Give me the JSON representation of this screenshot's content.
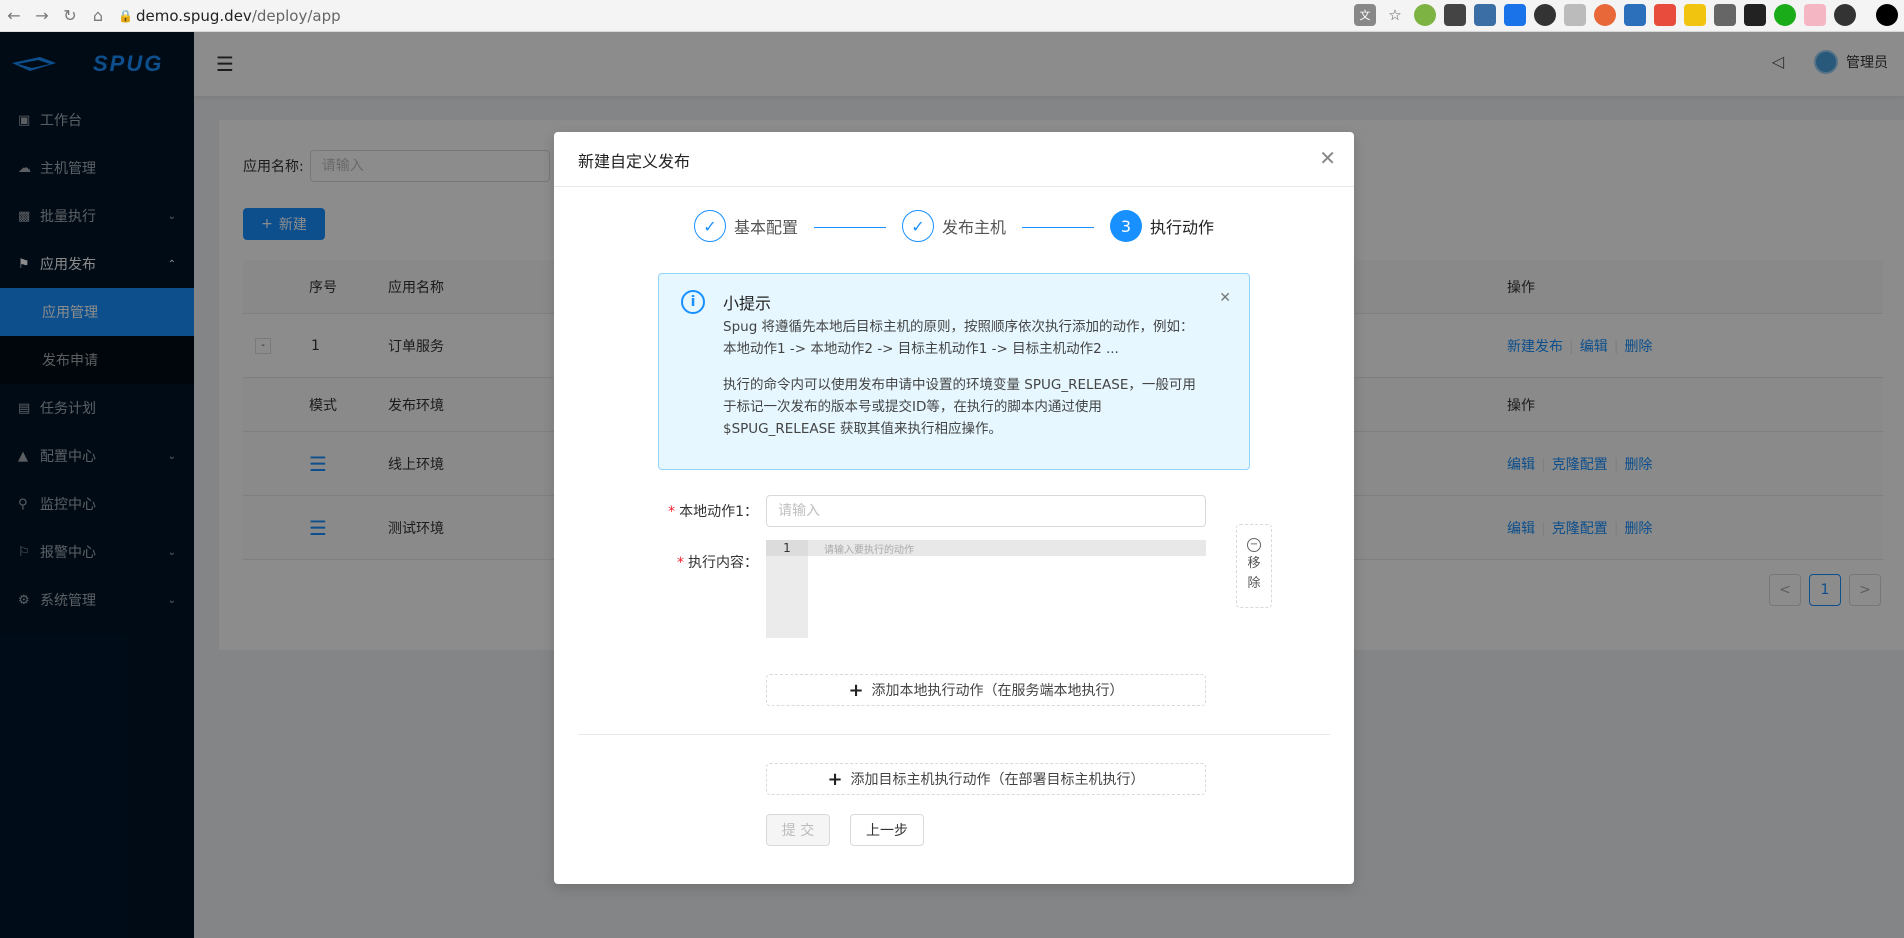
{
  "browser": {
    "url_host": "demo.spug.dev",
    "url_path": "/deploy/app"
  },
  "app": {
    "logo_text": "SPUG",
    "user_name": "管理员"
  },
  "sidebar": {
    "items": [
      {
        "label": "工作台",
        "icon": "desktop-icon"
      },
      {
        "label": "主机管理",
        "icon": "cloud-icon"
      },
      {
        "label": "批量执行",
        "icon": "code-icon",
        "has_arrow": true
      },
      {
        "label": "应用发布",
        "icon": "flag-icon",
        "has_arrow": true,
        "open": true
      },
      {
        "label": "应用管理",
        "selected": true,
        "sub": true
      },
      {
        "label": "发布申请",
        "sub": true
      },
      {
        "label": "任务计划",
        "icon": "schedule-icon"
      },
      {
        "label": "配置中心",
        "icon": "deployment-icon",
        "has_arrow": true
      },
      {
        "label": "监控中心",
        "icon": "monitor-icon"
      },
      {
        "label": "报警中心",
        "icon": "alert-icon",
        "has_arrow": true
      },
      {
        "label": "系统管理",
        "icon": "setting-icon",
        "has_arrow": true
      }
    ]
  },
  "page": {
    "search_label": "应用名称:",
    "search_placeholder": "请输入",
    "new_button": "新建",
    "table_headers": [
      "序号",
      "应用名称",
      "操作"
    ],
    "row": {
      "expand": "-",
      "index": "1",
      "name": "订单服务",
      "actions": [
        "新建发布",
        "编辑",
        "删除"
      ]
    },
    "sub_headers": [
      "模式",
      "发布环境",
      "操作"
    ],
    "sub_rows": [
      {
        "env": "线上环境",
        "actions": [
          "编辑",
          "克隆配置",
          "删除"
        ]
      },
      {
        "env": "测试环境",
        "actions": [
          "编辑",
          "克隆配置",
          "删除"
        ]
      }
    ],
    "pagination": {
      "prev": "<",
      "current": "1",
      "next": ">"
    }
  },
  "modal": {
    "title": "新建自定义发布",
    "steps": [
      {
        "title": "基本配置",
        "status": "done"
      },
      {
        "title": "发布主机",
        "status": "done"
      },
      {
        "title": "执行动作",
        "status": "process",
        "number": "3"
      }
    ],
    "alert": {
      "title": "小提示",
      "line1": "Spug 将遵循先本地后目标主机的原则，按照顺序依次执行添加的动作，例如：",
      "line2": "本地动作1 -> 本地动作2 -> 目标主机动作1 -> 目标主机动作2 ...",
      "line3": "执行的命令内可以使用发布申请中设置的环境变量 SPUG_RELEASE，一般可用",
      "line4": "于标记一次发布的版本号或提交ID等，在执行的脚本内通过使用",
      "line5": "$SPUG_RELEASE 获取其值来执行相应操作。"
    },
    "local_action_label": "本地动作1：",
    "local_action_placeholder": "请输入",
    "exec_content_label": "执行内容：",
    "editor_line_number": "1",
    "editor_placeholder": "请输入要执行的动作",
    "remove_label_1": "移",
    "remove_label_2": "除",
    "add_local_action": "添加本地执行动作（在服务端本地执行）",
    "add_target_action": "添加目标主机执行动作（在部署目标主机执行）",
    "submit_button": "提 交",
    "prev_button": "上一步"
  }
}
